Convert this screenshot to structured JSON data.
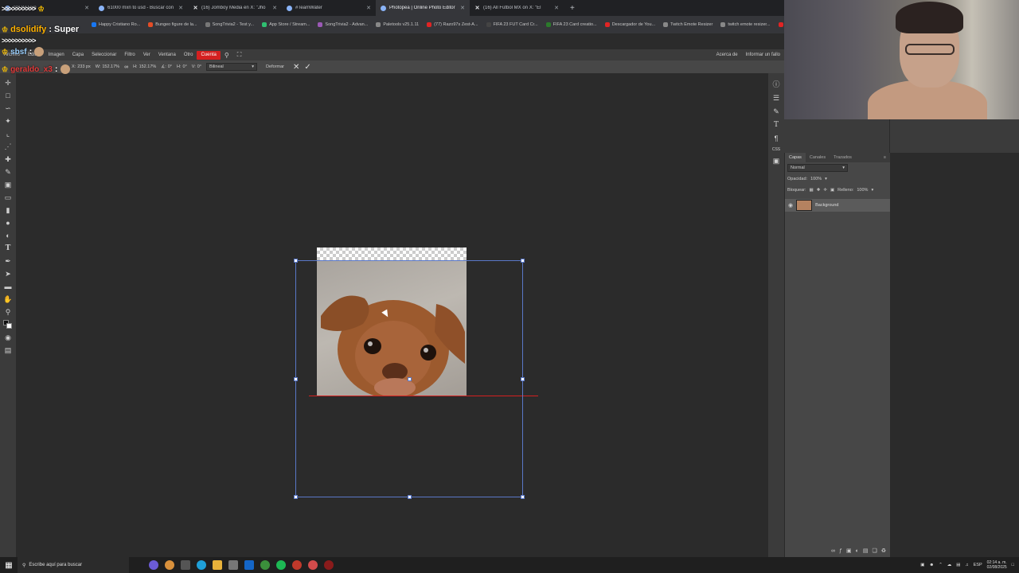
{
  "browser": {
    "tabs": [
      {
        "label": "CSTV Live",
        "active": false,
        "fav": "dot"
      },
      {
        "label": "61000 mxn to usd - Buscar con",
        "active": false,
        "fav": "dot"
      },
      {
        "label": "(16) Jomboy Media en X: \"Jho",
        "active": false,
        "fav": "x"
      },
      {
        "label": "#TeamWater",
        "active": false,
        "fav": "dot"
      },
      {
        "label": "Photopea | Online Photo Editor",
        "active": true,
        "fav": "dot"
      },
      {
        "label": "(16) All Fútbol MX on X: \"El",
        "active": false,
        "fav": "x"
      }
    ],
    "new_tab": "+",
    "bookmarks": [
      {
        "label": "Happy Cristiano Ro...",
        "color": "#1877f2"
      },
      {
        "label": "Bungeo figure de la...",
        "color": "#e44d26"
      },
      {
        "label": "SongTrivia2 - Test y...",
        "color": "#777"
      },
      {
        "label": "App Store / Stream...",
        "color": "#2fbf71"
      },
      {
        "label": "SongTrivia2 - Advan...",
        "color": "#9b59b6"
      },
      {
        "label": "Paletools v25.1.11",
        "color": "#888"
      },
      {
        "label": "(77) Razo97s Zest-A...",
        "color": "#e02424"
      },
      {
        "label": "FIFA 23 FUT Card Cr...",
        "color": "#444"
      },
      {
        "label": "FIFA 23 Card creatio...",
        "color": "#2b7a2b"
      },
      {
        "label": "Descargador de You...",
        "color": "#e02424"
      },
      {
        "label": "Twitch Emote Resizer",
        "color": "#888"
      },
      {
        "label": "twitch emote resizer...",
        "color": "#888"
      },
      {
        "label": "Estadia Pre",
        "color": "#e02424"
      }
    ]
  },
  "chat": {
    "arrows": ">>>>>>>>>>",
    "messages": [
      {
        "user": "dsolidify",
        "text": ": Super"
      },
      {
        "user": "sbsf",
        "text": ":"
      },
      {
        "user": "geraldo_x3",
        "text": ":"
      }
    ]
  },
  "menu": {
    "items": [
      "Archivo",
      "Editar",
      "Imagen",
      "Capa",
      "Seleccionar",
      "Filtro",
      "Ver",
      "Ventana",
      "Otro"
    ],
    "highlighted": "Cuenta",
    "right": [
      "Acerca de",
      "Informar un fallo"
    ]
  },
  "options": {
    "x_label": "X:",
    "x_value": "233 px",
    "w_label": "W:",
    "w_value": "152.17%",
    "h_label": "H:",
    "h_value": "152.17%",
    "angle_label": "∡:",
    "angle_value": "0°",
    "skew_h_label": "H:",
    "skew_h_value": "0°",
    "skew_v_label": "V:",
    "skew_v_value": "0°",
    "interpolation": "Bilineal",
    "warp": "Deformar"
  },
  "layers_panel": {
    "tabs": [
      "Capas",
      "Canales",
      "Trazados"
    ],
    "blend_mode": "Normal",
    "opacity_label": "Opacidad:",
    "opacity_value": "100%",
    "lock_label": "Bloquear:",
    "fill_label": "Relleno:",
    "fill_value": "100%",
    "layers": [
      {
        "name": "Background"
      }
    ]
  },
  "right_strip": {
    "css_label": "CSS"
  },
  "taskbar": {
    "search_placeholder": "Escribe aquí para buscar",
    "lang": "ESP",
    "time": "02:14 a. m.",
    "date": "02/08/2025"
  }
}
